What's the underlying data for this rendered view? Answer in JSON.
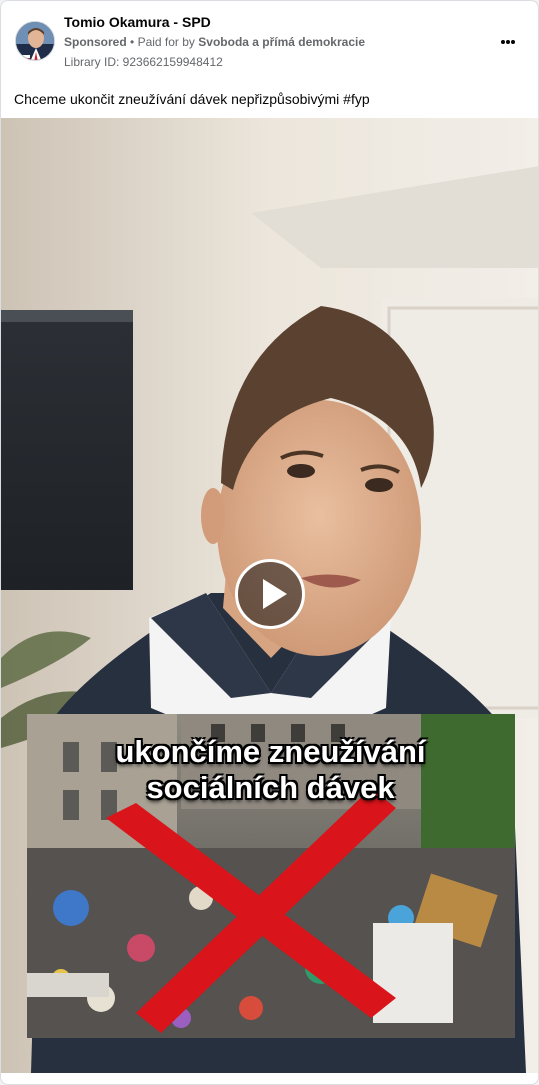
{
  "post": {
    "page_name": "Tomio Okamura - SPD",
    "sponsored_label": "Sponsored",
    "separator": "•",
    "paid_for_prefix": "Paid for by",
    "paid_for_name": "Svoboda a přímá demokracie",
    "library_id": "Library ID: 923662159948412",
    "more_icon": "three-dots-icon",
    "caption": "Chceme ukončit zneužívání dávek nepřizpůsobivými #fyp"
  },
  "video": {
    "overlay_line_1": "ukončíme zneužívání",
    "overlay_line_2": "sociálních dávek",
    "play_icon": "play-icon"
  },
  "colors": {
    "secondary_text": "#65676b",
    "cross": "#d9141a",
    "suit": "#27303f"
  }
}
